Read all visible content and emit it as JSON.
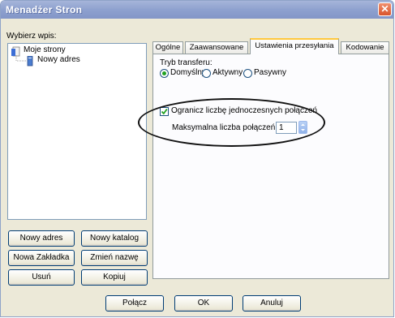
{
  "window": {
    "title": "Menadżer Stron",
    "close_glyph": "✕"
  },
  "left_panel": {
    "label": "Wybierz wpis:",
    "tree": {
      "root": "Moje strony",
      "child": "Nowy adres"
    },
    "buttons": {
      "new_site": "Nowy adres",
      "new_folder": "Nowy katalog",
      "new_bookmark": "Nowa Zakładka",
      "rename": "Zmień nazwę",
      "delete": "Usuń",
      "copy": "Kopiuj"
    }
  },
  "tabs": {
    "general": "Ogólne",
    "advanced": "Zaawansowane",
    "transfer": "Ustawienia przesyłania",
    "charset": "Kodowanie"
  },
  "transfer_settings": {
    "mode_label": "Tryb transferu:",
    "modes": {
      "default": "Domyślny",
      "active": "Aktywny",
      "passive": "Pasywny"
    },
    "selected_mode": "Domyślny",
    "limit_label": "Ogranicz liczbę jednoczesnych połączeń",
    "limit_checked": true,
    "max_label": "Maksymalna liczba połączeń:",
    "max_value": "1"
  },
  "footer": {
    "connect": "Połącz",
    "ok": "OK",
    "cancel": "Anuluj"
  },
  "colors": {
    "title_bar": "#8ea1cf",
    "close_button": "#d9542b",
    "active_tab_accent": "#ffc83c",
    "annotation": "#111111"
  }
}
